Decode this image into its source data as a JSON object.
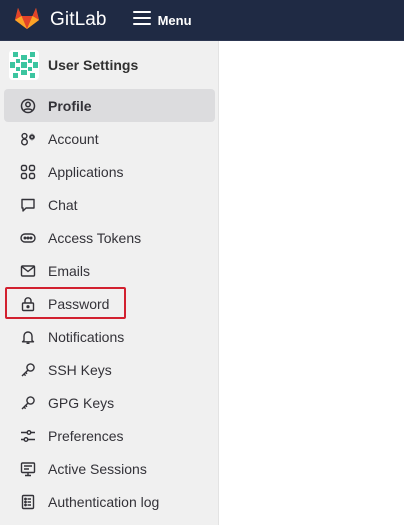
{
  "header": {
    "brand": "GitLab",
    "menu_label": "Menu",
    "logo_icon": "gitlab-tanuki-icon",
    "menu_icon": "hamburger-icon",
    "colors": {
      "bg": "#1f2a44",
      "logo_orange": "#e24329",
      "logo_light": "#fca326",
      "logo_mid": "#fc6d26"
    }
  },
  "sidebar": {
    "context_title": "User Settings",
    "items": [
      {
        "label": "Profile",
        "icon": "user-circle-icon",
        "active": true
      },
      {
        "label": "Account",
        "icon": "account-icon",
        "active": false
      },
      {
        "label": "Applications",
        "icon": "applications-icon",
        "active": false
      },
      {
        "label": "Chat",
        "icon": "chat-icon",
        "active": false
      },
      {
        "label": "Access Tokens",
        "icon": "token-icon",
        "active": false
      },
      {
        "label": "Emails",
        "icon": "mail-icon",
        "active": false
      },
      {
        "label": "Password",
        "icon": "lock-icon",
        "active": false,
        "highlighted": true
      },
      {
        "label": "Notifications",
        "icon": "bell-icon",
        "active": false
      },
      {
        "label": "SSH Keys",
        "icon": "key-icon",
        "active": false
      },
      {
        "label": "GPG Keys",
        "icon": "key-icon",
        "active": false
      },
      {
        "label": "Preferences",
        "icon": "preferences-icon",
        "active": false
      },
      {
        "label": "Active Sessions",
        "icon": "monitor-icon",
        "active": false
      },
      {
        "label": "Authentication log",
        "icon": "log-icon",
        "active": false
      }
    ],
    "colors": {
      "bg": "#f0f0f0",
      "active_bg": "#dcdcde",
      "highlight": "#d2202f"
    }
  }
}
